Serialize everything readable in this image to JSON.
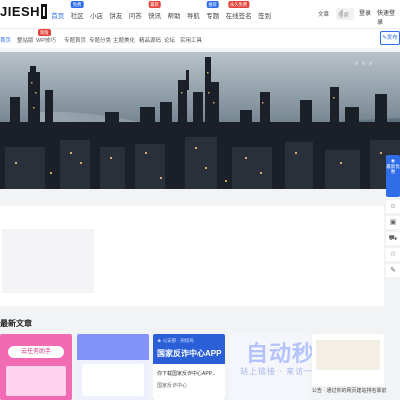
{
  "header": {
    "logo": "JIESHI",
    "nav": [
      {
        "label": "首页",
        "active": true,
        "badge": "",
        "badge_color": ""
      },
      {
        "label": "社区",
        "badge": "免费",
        "badge_color": "#2f6ee8"
      },
      {
        "label": "小店",
        "badge": "",
        "badge_color": ""
      },
      {
        "label": "饼友",
        "badge": "",
        "badge_color": ""
      },
      {
        "label": "问答",
        "badge": "",
        "badge_color": ""
      },
      {
        "label": "快讯",
        "badge": "最新",
        "badge_color": "#e2443b"
      },
      {
        "label": "帮助",
        "badge": "",
        "badge_color": ""
      },
      {
        "label": "导航",
        "badge": "",
        "badge_color": ""
      },
      {
        "label": "专题",
        "badge": "推荐",
        "badge_color": "#2f6ee8"
      },
      {
        "label": "在线签名",
        "badge": "永久免费",
        "badge_color": "#e2443b"
      },
      {
        "label": "签到",
        "badge": "",
        "badge_color": ""
      }
    ],
    "search_select": "文章",
    "search_placeholder": "搜索",
    "search_icon": "search-icon",
    "login": "登录",
    "quick_login": "快速登录"
  },
  "subnav": {
    "items": [
      "首页",
      "整站版",
      "WP技巧",
      "专题首页",
      "专题分类",
      "主题美化",
      "精品源码",
      "论坛",
      "实用工具"
    ],
    "active_index": 0,
    "badge": "新版"
  },
  "publish_btn": "发布",
  "banner": {
    "alt": "夜景城市全景"
  },
  "side_tools": {
    "main_label": "最新优惠",
    "buttons": [
      "chat-icon",
      "bag-icon",
      "cart-icon",
      "star-icon",
      "edit-icon"
    ]
  },
  "section_title": "最新文章",
  "cards": [
    {
      "title": "云任务助手",
      "color": "#f06bb3"
    },
    {
      "title": "",
      "color": "#7f8dfa"
    },
    {
      "title": "国家反诈中心APP",
      "color": "#2b5fd8"
    },
    {
      "title": "",
      "color": "#f4f6fb"
    }
  ],
  "card3_text": "你下载国家反诈中心APP...",
  "card3_sub": "国家反诈中心",
  "watermark": {
    "main": "自动秒收录",
    "sub": "站上链接 · 来访一次 · 秒收录"
  },
  "right_note": "公告 · 通过你的网页建站排名靠前"
}
